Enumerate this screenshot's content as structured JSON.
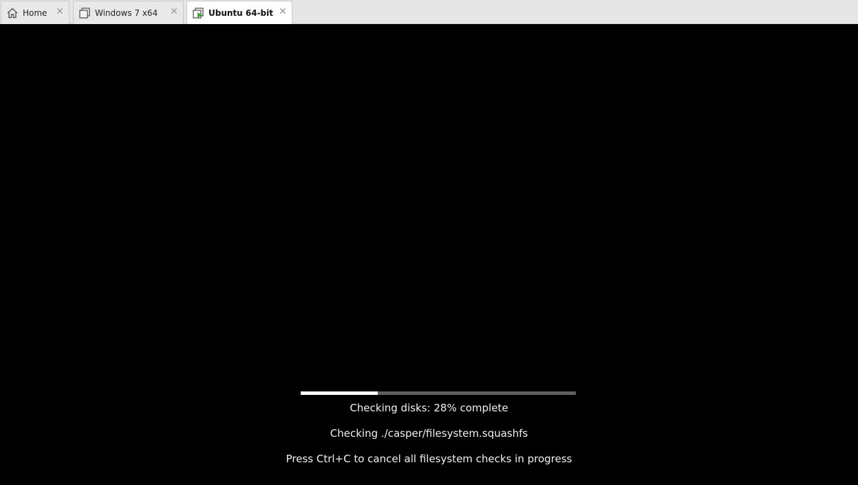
{
  "tabs": [
    {
      "label": "Home",
      "icon": "home-icon",
      "active": false
    },
    {
      "label": "Windows 7 x64",
      "icon": "vm-icon",
      "active": false
    },
    {
      "label": "Ubuntu 64-bit",
      "icon": "vm-running-icon",
      "active": true
    }
  ],
  "tab_close_glyph": "✕",
  "console": {
    "progress_percent": 28,
    "status_line": "Checking disks: 28% complete",
    "file_line": "Checking ./casper/filesystem.squashfs",
    "hint_line": "Press Ctrl+C to cancel all filesystem checks in progress"
  },
  "colors": {
    "background": "#000000",
    "progress_fill": "#ffffff",
    "progress_track": "#5f5f5f",
    "running_accent": "#3aa832"
  }
}
